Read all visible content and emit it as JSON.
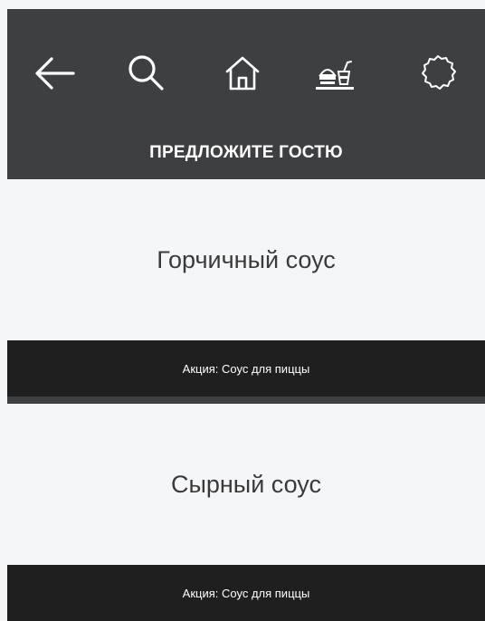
{
  "header": {
    "title": "ПРЕДЛОЖИТЕ ГОСТЮ",
    "icons": [
      "back-arrow-icon",
      "search-icon",
      "home-icon",
      "food-tray-icon",
      "settings-badge-icon"
    ],
    "background": "#3e3f41"
  },
  "items": [
    {
      "name": "Горчичный соус",
      "promo": "Акция: Соус для пиццы"
    },
    {
      "name": "Сырный соус",
      "promo": "Акция: Соус для пиццы"
    }
  ],
  "colors": {
    "page_bg": "#f5f6f8",
    "promo_bg": "#1f1f20",
    "text": "#3a3a3a"
  }
}
